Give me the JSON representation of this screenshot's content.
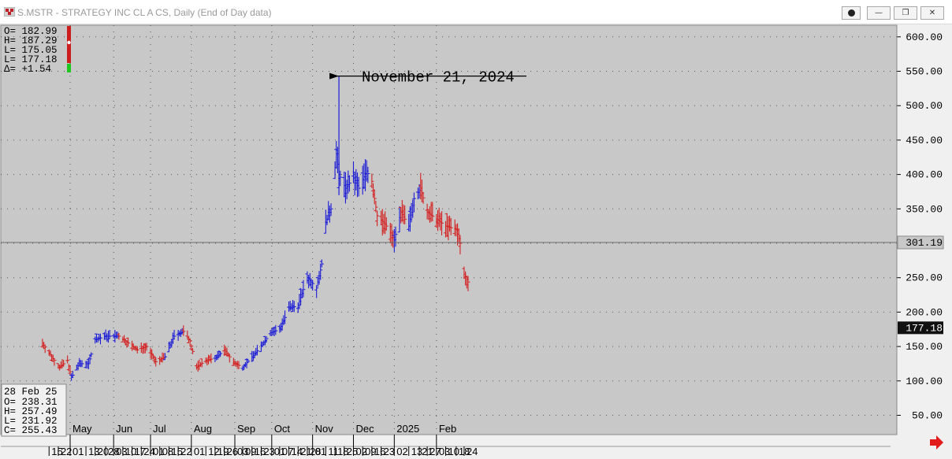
{
  "window": {
    "title": "S.MSTR - STRATEGY INC CL A CS, Daily (End of Day data)",
    "controls": [
      "dot",
      "minimize",
      "restore",
      "close"
    ]
  },
  "info_top": {
    "open": "O= 182.99",
    "high": "H= 187.29",
    "low": "L= 175.05",
    "last": "L= 177.18",
    "change": "Δ=   +1.54"
  },
  "info_bottom": {
    "date": "28 Feb 25",
    "open": "O=   238.31",
    "high": "H=   257.49",
    "low": "L=   231.92",
    "close": "C=   255.43"
  },
  "annotation": {
    "text": "November 21, 2024",
    "date": "2024-11-21",
    "value": 543
  },
  "price_markers": [
    {
      "value": 301.19,
      "label": "301.19",
      "style": "light"
    },
    {
      "value": 177.18,
      "label": "177.18",
      "style": "dark"
    }
  ],
  "colors": {
    "up": "#1c1cd6",
    "down": "#d42020",
    "background": "#c8c8c8",
    "grid": "#555555",
    "panel": "#f0f0f0",
    "nav_arrow": "#e21b1b"
  },
  "chart_data": {
    "type": "ohlc",
    "title": "S.MSTR - STRATEGY INC CL A CS, Daily (End of Day data)",
    "y_axis": {
      "min": 50,
      "max": 600,
      "step": 50,
      "side": "right",
      "tick_labels": [
        "600.00",
        "550.00",
        "500.00",
        "450.00",
        "400.00",
        "350.00",
        "300.00",
        "250.00",
        "200.00",
        "150.00",
        "100.00",
        "50.00"
      ]
    },
    "grid": true,
    "x_axis": {
      "months": [
        {
          "label": "May",
          "date": "2024-05-01"
        },
        {
          "label": "Jun",
          "date": "2024-06-03"
        },
        {
          "label": "Jul",
          "date": "2024-07-01"
        },
        {
          "label": "Aug",
          "date": "2024-08-01"
        },
        {
          "label": "Sep",
          "date": "2024-09-03"
        },
        {
          "label": "Oct",
          "date": "2024-10-01"
        },
        {
          "label": "Nov",
          "date": "2024-11-01"
        },
        {
          "label": "Dec",
          "date": "2024-12-02"
        },
        {
          "label": "2025",
          "date": "2025-01-02"
        },
        {
          "label": "Feb",
          "date": "2025-02-03"
        }
      ],
      "days": [
        {
          "label": "15",
          "date": "2024-04-15"
        },
        {
          "label": "22",
          "date": "2024-04-22"
        },
        {
          "label": "01",
          "date": "2024-05-01"
        },
        {
          "label": "13",
          "date": "2024-05-13"
        },
        {
          "label": "20",
          "date": "2024-05-20"
        },
        {
          "label": "28",
          "date": "2024-05-28"
        },
        {
          "label": "03",
          "date": "2024-06-03"
        },
        {
          "label": "10",
          "date": "2024-06-10"
        },
        {
          "label": "17",
          "date": "2024-06-17"
        },
        {
          "label": "24",
          "date": "2024-06-24"
        },
        {
          "label": "01",
          "date": "2024-07-01"
        },
        {
          "label": "08",
          "date": "2024-07-08"
        },
        {
          "label": "15",
          "date": "2024-07-15"
        },
        {
          "label": "22",
          "date": "2024-07-22"
        },
        {
          "label": "01",
          "date": "2024-08-01"
        },
        {
          "label": "12",
          "date": "2024-08-12"
        },
        {
          "label": "19",
          "date": "2024-08-19"
        },
        {
          "label": "26",
          "date": "2024-08-26"
        },
        {
          "label": "03",
          "date": "2024-09-03"
        },
        {
          "label": "09",
          "date": "2024-09-09"
        },
        {
          "label": "16",
          "date": "2024-09-16"
        },
        {
          "label": "23",
          "date": "2024-09-23"
        },
        {
          "label": "01",
          "date": "2024-10-01"
        },
        {
          "label": "07",
          "date": "2024-10-07"
        },
        {
          "label": "14",
          "date": "2024-10-14"
        },
        {
          "label": "21",
          "date": "2024-10-21"
        },
        {
          "label": "28",
          "date": "2024-10-28"
        },
        {
          "label": "01",
          "date": "2024-11-01"
        },
        {
          "label": "11",
          "date": "2024-11-11"
        },
        {
          "label": "18",
          "date": "2024-11-18"
        },
        {
          "label": "25",
          "date": "2024-11-25"
        },
        {
          "label": "02",
          "date": "2024-12-02"
        },
        {
          "label": "09",
          "date": "2024-12-09"
        },
        {
          "label": "16",
          "date": "2024-12-16"
        },
        {
          "label": "23",
          "date": "2024-12-23"
        },
        {
          "label": "02",
          "date": "2025-01-02"
        },
        {
          "label": "13",
          "date": "2025-01-13"
        },
        {
          "label": "21",
          "date": "2025-01-21"
        },
        {
          "label": "27",
          "date": "2025-01-27"
        },
        {
          "label": "03",
          "date": "2025-02-03"
        },
        {
          "label": "10",
          "date": "2025-02-10"
        },
        {
          "label": "18",
          "date": "2025-02-18"
        },
        {
          "label": "24",
          "date": "2025-02-24"
        }
      ]
    },
    "series": [
      {
        "segments": [
          {
            "date": "2024-04-10",
            "close": 155,
            "trend": "down"
          },
          {
            "date": "2024-04-17",
            "close": 135,
            "trend": "down"
          },
          {
            "date": "2024-04-23",
            "close": 120,
            "trend": "down"
          },
          {
            "date": "2024-04-29",
            "close": 130,
            "trend": "down"
          },
          {
            "date": "2024-05-02",
            "close": 105,
            "trend": "down"
          },
          {
            "date": "2024-05-08",
            "close": 125,
            "trend": "up"
          },
          {
            "date": "2024-05-15",
            "close": 125,
            "trend": "up"
          },
          {
            "date": "2024-05-20",
            "close": 160,
            "trend": "up"
          },
          {
            "date": "2024-05-28",
            "close": 165,
            "trend": "up"
          },
          {
            "date": "2024-06-07",
            "close": 165,
            "trend": "up"
          },
          {
            "date": "2024-06-14",
            "close": 155,
            "trend": "down"
          },
          {
            "date": "2024-06-21",
            "close": 145,
            "trend": "down"
          },
          {
            "date": "2024-06-28",
            "close": 150,
            "trend": "down"
          },
          {
            "date": "2024-07-05",
            "close": 128,
            "trend": "down"
          },
          {
            "date": "2024-07-12",
            "close": 135,
            "trend": "down"
          },
          {
            "date": "2024-07-19",
            "close": 165,
            "trend": "up"
          },
          {
            "date": "2024-07-26",
            "close": 172,
            "trend": "up"
          },
          {
            "date": "2024-07-31",
            "close": 158,
            "trend": "down"
          },
          {
            "date": "2024-08-05",
            "close": 120,
            "trend": "down"
          },
          {
            "date": "2024-08-12",
            "close": 130,
            "trend": "down"
          },
          {
            "date": "2024-08-19",
            "close": 133,
            "trend": "down"
          },
          {
            "date": "2024-08-26",
            "close": 145,
            "trend": "up"
          },
          {
            "date": "2024-09-03",
            "close": 125,
            "trend": "down"
          },
          {
            "date": "2024-09-09",
            "close": 120,
            "trend": "down"
          },
          {
            "date": "2024-09-16",
            "close": 135,
            "trend": "up"
          },
          {
            "date": "2024-09-23",
            "close": 150,
            "trend": "up"
          },
          {
            "date": "2024-09-30",
            "close": 170,
            "trend": "up"
          },
          {
            "date": "2024-10-07",
            "close": 175,
            "trend": "up"
          },
          {
            "date": "2024-10-14",
            "close": 205,
            "trend": "up"
          },
          {
            "date": "2024-10-21",
            "close": 210,
            "trend": "up"
          },
          {
            "date": "2024-10-28",
            "close": 250,
            "trend": "up"
          },
          {
            "date": "2024-11-04",
            "close": 235,
            "trend": "up"
          },
          {
            "date": "2024-11-08",
            "close": 270,
            "trend": "up"
          },
          {
            "date": "2024-11-11",
            "close": 330,
            "trend": "up"
          },
          {
            "date": "2024-11-15",
            "close": 350,
            "trend": "up"
          },
          {
            "date": "2024-11-19",
            "close": 430,
            "trend": "up"
          },
          {
            "date": "2024-11-21",
            "close": 400,
            "trend": "up"
          },
          {
            "date": "2024-11-26",
            "close": 380,
            "trend": "up"
          },
          {
            "date": "2024-12-02",
            "close": 395,
            "trend": "up"
          },
          {
            "date": "2024-12-06",
            "close": 380,
            "trend": "up"
          },
          {
            "date": "2024-12-12",
            "close": 405,
            "trend": "up"
          },
          {
            "date": "2024-12-16",
            "close": 390,
            "trend": "up"
          },
          {
            "date": "2024-12-20",
            "close": 340,
            "trend": "down"
          },
          {
            "date": "2024-12-27",
            "close": 325,
            "trend": "down"
          },
          {
            "date": "2025-01-02",
            "close": 305,
            "trend": "down"
          },
          {
            "date": "2025-01-07",
            "close": 345,
            "trend": "up"
          },
          {
            "date": "2025-01-13",
            "close": 325,
            "trend": "down"
          },
          {
            "date": "2025-01-17",
            "close": 365,
            "trend": "up"
          },
          {
            "date": "2025-01-22",
            "close": 380,
            "trend": "up"
          },
          {
            "date": "2025-01-27",
            "close": 345,
            "trend": "down"
          },
          {
            "date": "2025-02-03",
            "close": 335,
            "trend": "down"
          },
          {
            "date": "2025-02-10",
            "close": 325,
            "trend": "down"
          },
          {
            "date": "2025-02-18",
            "close": 320,
            "trend": "down"
          },
          {
            "date": "2025-02-21",
            "close": 300,
            "trend": "down"
          },
          {
            "date": "2025-02-24",
            "close": 255,
            "trend": "down"
          },
          {
            "date": "2025-02-28",
            "close": 240,
            "trend": "down"
          }
        ]
      }
    ]
  }
}
